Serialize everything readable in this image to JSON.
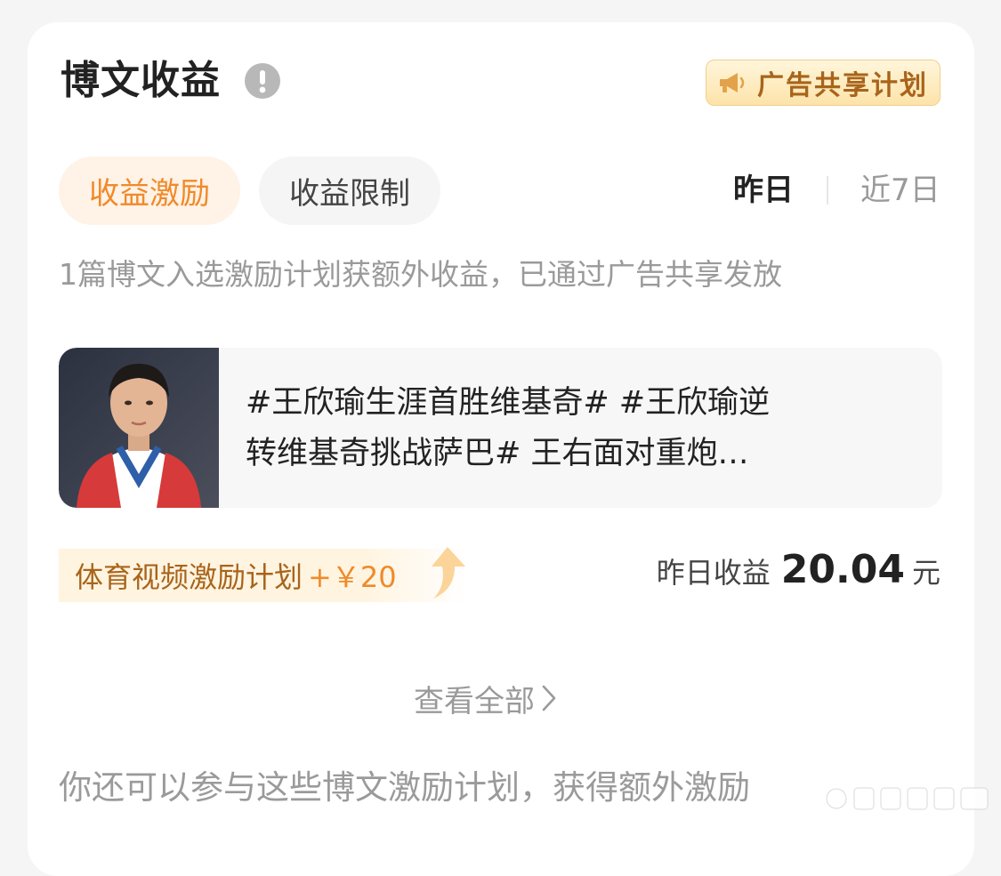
{
  "section": {
    "title": "博文收益",
    "info_icon": "info-exclamation-icon"
  },
  "ad_badge": {
    "icon": "megaphone-icon",
    "label": "广告共享计划"
  },
  "tabs": [
    {
      "label": "收益激励",
      "active": true
    },
    {
      "label": "收益限制",
      "active": false
    }
  ],
  "period": {
    "options": [
      "昨日",
      "近7日"
    ],
    "selected": "昨日"
  },
  "description": "1篇博文入选激励计划获额外收益，已通过广告共享发放",
  "post": {
    "line1": "#王欣瑜生涯首胜维基奇# #王欣瑜逆",
    "line2": "转维基奇挑战萨巴# 王右面对重炮…"
  },
  "reward": {
    "plan_label": "体育视频激励计划",
    "amount": "+￥20"
  },
  "earnings": {
    "label": "昨日收益",
    "value": "20.04",
    "unit": "元"
  },
  "view_all": {
    "label": "查看全部",
    "icon": "chevron-right-icon"
  },
  "bottom_text": "你还可以参与这些博文激励计划，获得额外激励",
  "colors": {
    "accent_orange": "#f08a2a",
    "badge_brown": "#a8641b",
    "text_primary": "#222222",
    "text_secondary": "#9a9a9a"
  }
}
